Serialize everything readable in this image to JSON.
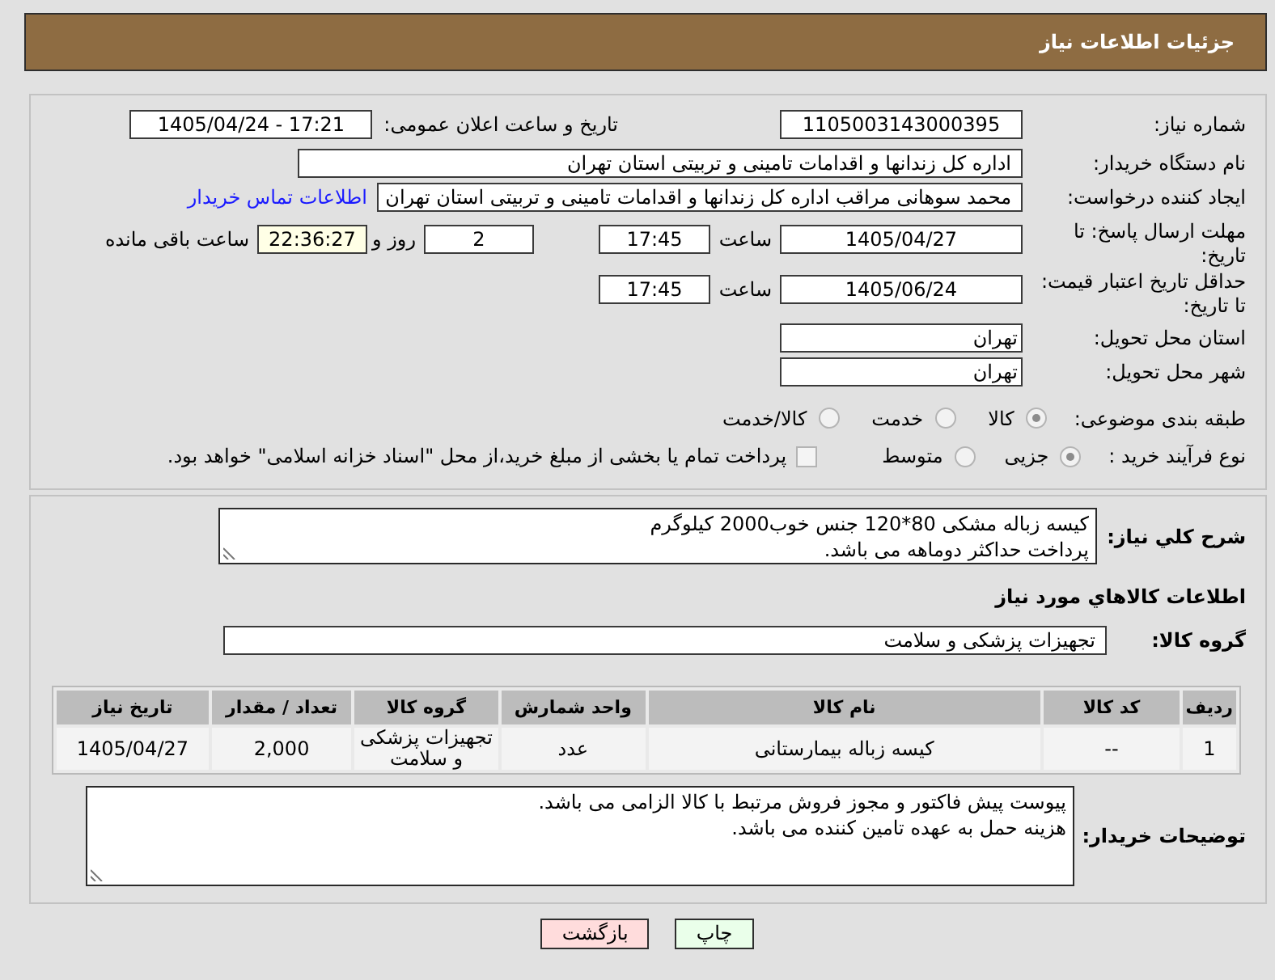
{
  "header": {
    "title": "جزئیات اطلاعات نیاز"
  },
  "details": {
    "need_number": {
      "label": "شماره نیاز:",
      "value": "1105003143000395"
    },
    "announcement": {
      "label": "تاریخ و ساعت اعلان عمومی:",
      "value": "1405/04/24 - 17:21"
    },
    "buyer_org": {
      "label": "نام دستگاه خریدار:",
      "value": "اداره کل زندانها و اقدامات تامینی و تربیتی استان تهران"
    },
    "requester": {
      "label": "ایجاد کننده درخواست:",
      "value": "محمد سوهانی مراقب اداره کل زندانها و اقدامات تامینی و تربیتی استان تهران",
      "contact_link": "اطلاعات تماس خریدار"
    },
    "response_deadline": {
      "label": "مهلت ارسال پاسخ: تا تاریخ:",
      "date": "1405/04/27",
      "time_label": "ساعت",
      "time": "17:45",
      "days": "2",
      "days_label": "روز و",
      "remaining": "22:36:27",
      "remaining_label": "ساعت باقی مانده"
    },
    "price_validity": {
      "label": "حداقل تاریخ اعتبار قیمت: تا تاریخ:",
      "date": "1405/06/24",
      "time_label": "ساعت",
      "time": "17:45"
    },
    "delivery_province": {
      "label": "استان محل تحویل:",
      "value": "تهران"
    },
    "delivery_city": {
      "label": "شهر محل تحویل:",
      "value": "تهران"
    },
    "subject_category": {
      "label": "طبقه بندی موضوعی:",
      "options": [
        {
          "label": "کالا",
          "selected": true
        },
        {
          "label": "خدمت",
          "selected": false
        },
        {
          "label": "کالا/خدمت",
          "selected": false
        }
      ]
    },
    "purchase_type": {
      "label": "نوع فرآیند خرید :",
      "options": [
        {
          "label": "جزیی",
          "selected": true
        },
        {
          "label": "متوسط",
          "selected": false
        }
      ],
      "treasury_payment": {
        "label": "پرداخت تمام یا بخشی از مبلغ خرید،از محل \"اسناد خزانه اسلامی\" خواهد بود.",
        "checked": false
      }
    }
  },
  "description": {
    "label": "شرح كلي نياز:",
    "value": "کیسه زباله مشکی 80*120 جنس خوب2000 کیلوگرم\nپرداخت حداکثر دوماهه می باشد."
  },
  "goods": {
    "heading": "اطلاعات كالاهاي مورد نياز",
    "group": {
      "label": "گروه کالا:",
      "value": "تجهیزات پزشکی و سلامت"
    },
    "table": {
      "columns": [
        "ردیف",
        "کد کالا",
        "نام کالا",
        "واحد شمارش",
        "گروه کالا",
        "تعداد / مقدار",
        "تاریخ نیاز"
      ],
      "rows": [
        [
          "1",
          "--",
          "کیسه زباله بیمارستانی",
          "عدد",
          "تجهیزات پزشکی و سلامت",
          "2,000",
          "1405/04/27"
        ]
      ]
    }
  },
  "buyer_notes": {
    "label": "توضیحات خریدار:",
    "value": "پیوست پیش فاکتور و مجوز فروش مرتبط با کالا الزامی می باشد.\nهزینه حمل به عهده تامین کننده می باشد."
  },
  "buttons": [
    {
      "label": "چاپ",
      "kind": "print"
    },
    {
      "label": "بازگشت",
      "kind": "back"
    }
  ]
}
